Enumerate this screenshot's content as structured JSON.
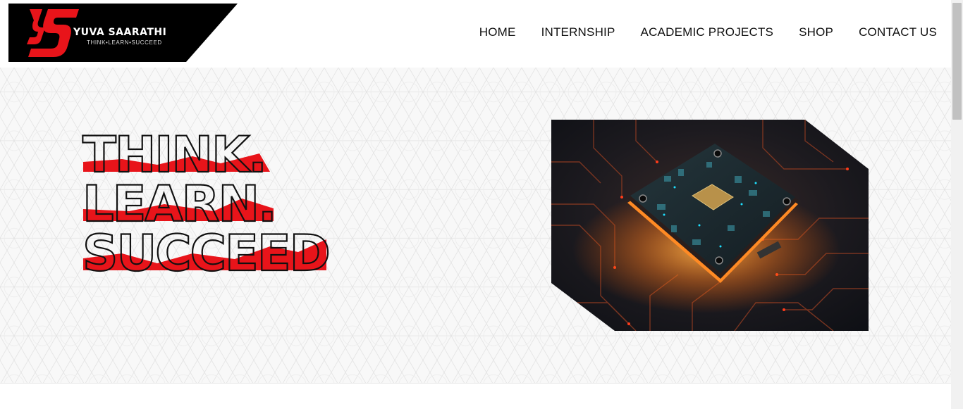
{
  "brand": {
    "name": "YUVA SAARATHI",
    "tagline": "THINK•LEARN•SUCCEED",
    "logo_mark_icon": "ys-monogram-icon"
  },
  "nav": {
    "items": [
      {
        "label": "HOME"
      },
      {
        "label": "INTERNSHIP"
      },
      {
        "label": "ACADEMIC PROJECTS"
      },
      {
        "label": "SHOP"
      },
      {
        "label": "CONTACT US"
      }
    ]
  },
  "hero": {
    "headline": [
      "THINK.",
      "LEARN.",
      "SUCCEED"
    ],
    "image_icon": "circuit-chip-image"
  },
  "colors": {
    "accent": "#e8141a",
    "logo_bg": "#000000",
    "headline_outline": "#111111",
    "nav_text": "#111111"
  }
}
